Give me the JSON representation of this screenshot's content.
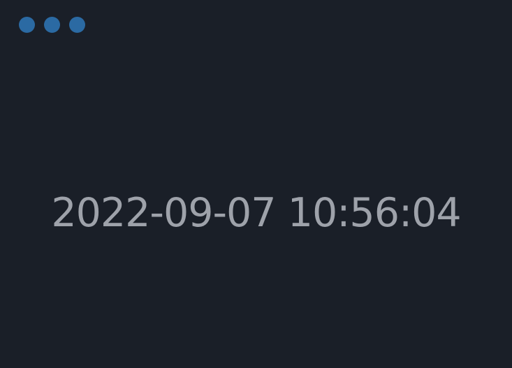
{
  "window_controls": {
    "icons": [
      "circle-icon",
      "circle-icon",
      "circle-icon"
    ],
    "color": "#2b6aa3"
  },
  "clock": {
    "datetime": "2022-09-07 10:56:04",
    "color": "#9ea2aa"
  },
  "colors": {
    "background": "#1a1f28"
  }
}
